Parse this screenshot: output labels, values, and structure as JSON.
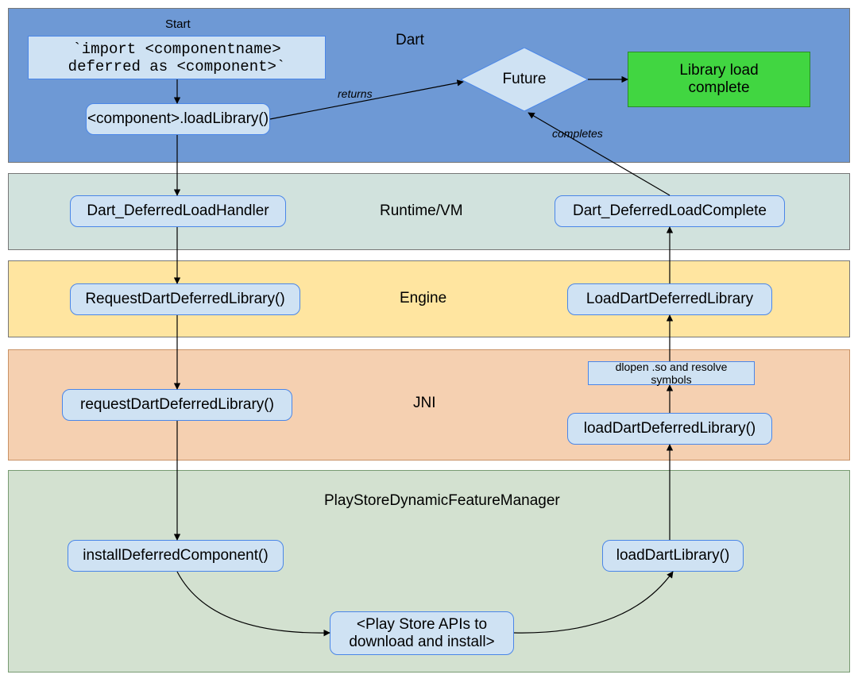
{
  "layers": {
    "dart": "Dart",
    "runtime": "Runtime/VM",
    "engine": "Engine",
    "jni": "JNI",
    "playstore": "PlayStoreDynamicFeatureManager"
  },
  "start_label": "Start",
  "nodes": {
    "import_stmt": "`import <componentname>\ndeferred as <component>`",
    "load_library": "<component>.loadLibrary()",
    "future": "Future",
    "library_complete": "Library load\ncomplete",
    "dart_deferred_handler": "Dart_DeferredLoadHandler",
    "dart_deferred_complete": "Dart_DeferredLoadComplete",
    "request_dart_deferred_engine": "RequestDartDeferredLibrary()",
    "load_dart_deferred_engine": "LoadDartDeferredLibrary",
    "request_dart_deferred_jni": "requestDartDeferredLibrary()",
    "dlopen_note": "dlopen .so and resolve symbols",
    "load_dart_deferred_jni": "loadDartDeferredLibrary()",
    "install_deferred": "installDeferredComponent()",
    "load_dart_library": "loadDartLibrary()",
    "playstore_apis": "<Play Store APIs to\ndownload and install>"
  },
  "edges": {
    "returns": "returns",
    "completes": "completes"
  }
}
